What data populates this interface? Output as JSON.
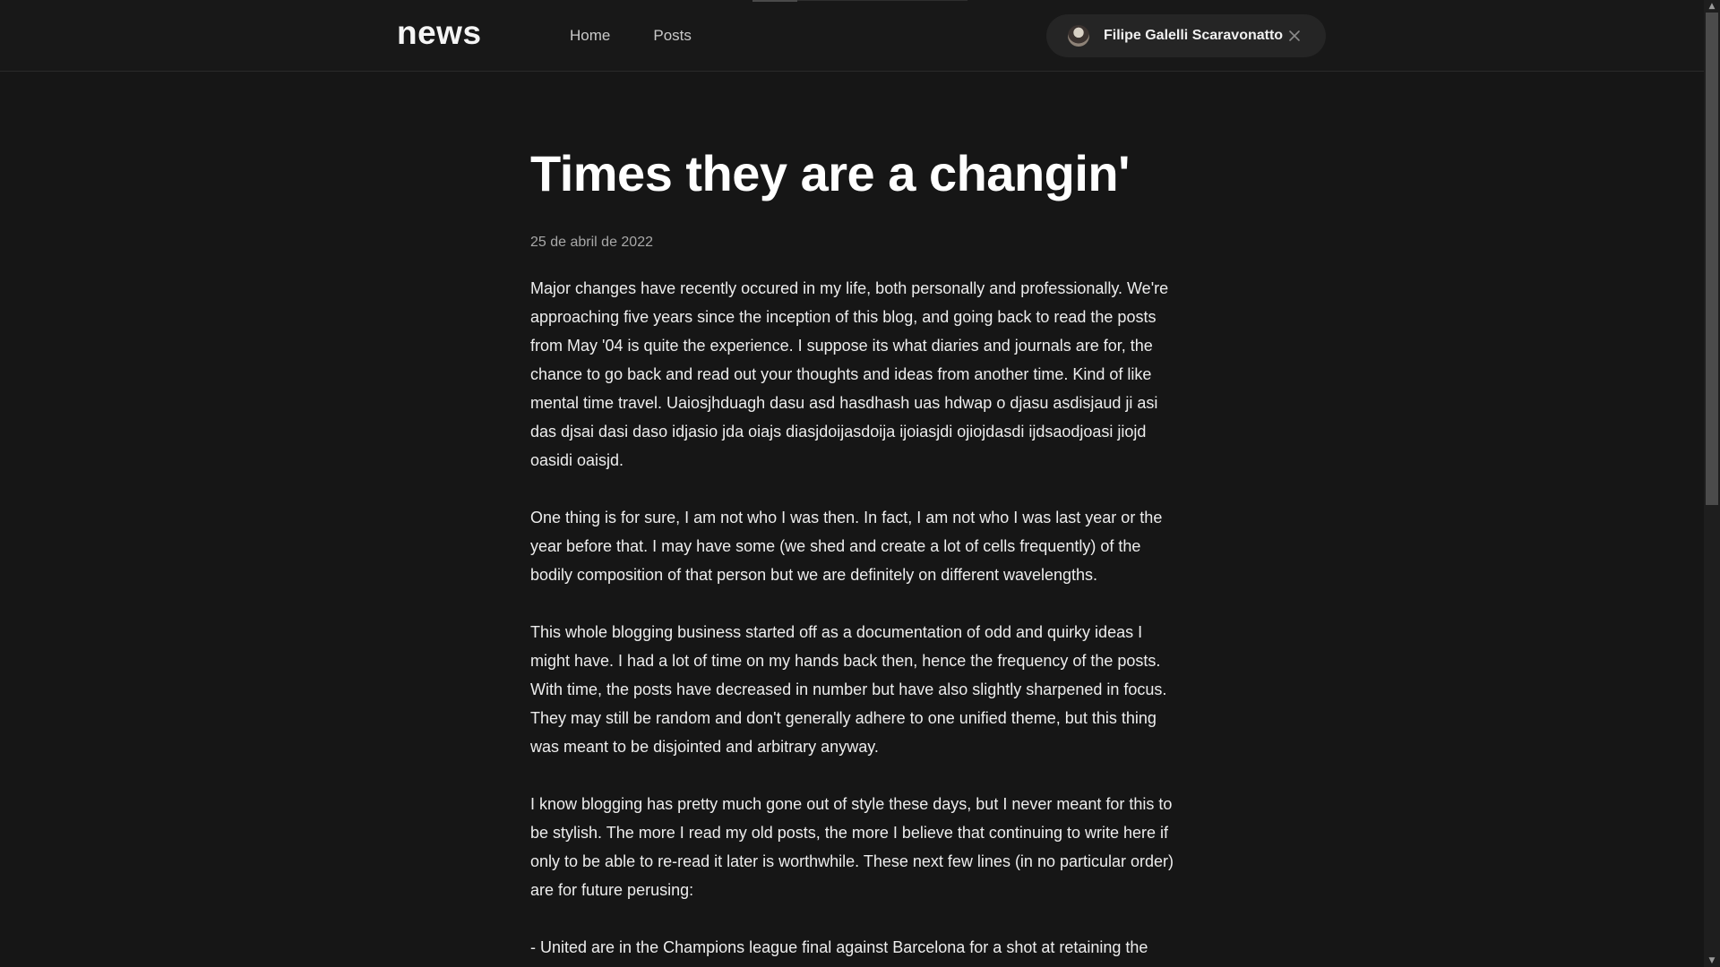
{
  "header": {
    "logo": "news",
    "nav": [
      {
        "label": "Home"
      },
      {
        "label": "Posts"
      }
    ],
    "user": {
      "name": "Filipe Galelli Scaravonatto"
    }
  },
  "post": {
    "title": "Times they are a changin'",
    "date": "25 de abril de 2022",
    "paragraphs": [
      "Major changes have recently occured in my life, both personally and professionally. We're approaching five years since the inception of this blog, and going back to read the posts from May '04 is quite the experience. I suppose its what diaries and journals are for, the chance to go back and read out your thoughts and ideas from another time. Kind of like mental time travel. Uaiosjhduagh dasu asd hasdhash uas hdwap o djasu asdisjaud ji asi das djsai dasi daso idjasio jda oiajs diasjdoijasdoija ijoiasjdi ojiojdasdi ijdsaodjoasi jiojd oasidi oaisjd.",
      "One thing is for sure, I am not who I was then. In fact, I am not who I was last year or the year before that. I may have some (we shed and create a lot of cells frequently) of the bodily composition of that person but we are definitely on different wavelengths.",
      "This whole blogging business started off as a documentation of odd and quirky ideas I might have. I had a lot of time on my hands back then, hence the frequency of the posts. With time, the posts have decreased in number but have also slightly sharpened in focus. They may still be random and don't generally adhere to one unified theme, but this thing was meant to be disjointed and arbitrary anyway.",
      "I know blogging has pretty much gone out of style these days, but I never meant for this to be stylish. The more I read my old posts, the more I believe that continuing to write here if only to be able to re-read it later is worthwhile. These next few lines (in no particular order) are for future perusing:",
      "- United are in the Champions league final against Barcelona for a shot at retaining the"
    ]
  },
  "colors": {
    "background": "#161616",
    "header": "#181818",
    "chip": "#252525",
    "text": "#ededed"
  }
}
